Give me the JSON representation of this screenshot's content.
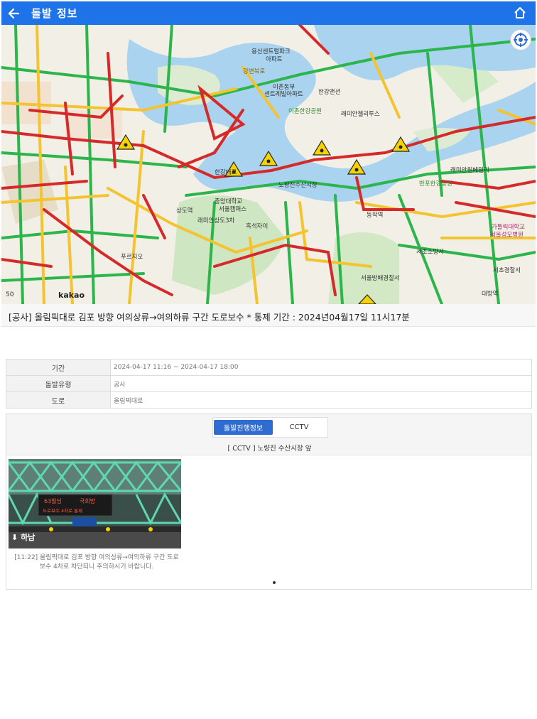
{
  "header": {
    "title": "돌발 정보"
  },
  "map": {
    "scale_label": "50",
    "brand": "kakao",
    "labels": [
      "용산센트럴파크",
      "아파트",
      "이촌동부",
      "센트레빌아파트",
      "한강맨션",
      "이촌한강공원",
      "래미안첼리투스",
      "강변북로",
      "중앙대학교",
      "서울캠퍼스",
      "흑석자이",
      "상도역",
      "동작역",
      "반포한강공원",
      "래미안원베일리",
      "서초소방서",
      "서울방배경찰서",
      "대방역",
      "래미안상도3차",
      "푸르지오",
      "서초경찰서",
      "가톨릭대학교",
      "서울성모병원",
      "노량진수산시장",
      "한강대교"
    ]
  },
  "event": {
    "title": "[공사] 올림픽대로 김포 방향 여의상류→여의하류 구간 도로보수 * 통제 기간 : 2024년04월17일 11시17분"
  },
  "info": {
    "rows": [
      {
        "label": "기간",
        "value": "2024-04-17 11:16 ~ 2024-04-17 18:00"
      },
      {
        "label": "돌발유형",
        "value": "공사"
      },
      {
        "label": "도로",
        "value": "올림픽대로"
      }
    ]
  },
  "tabs": {
    "progress": "돌발진행정보",
    "cctv": "CCTV"
  },
  "cctv": {
    "caption": "[ CCTV ] 노량진 수산시장 앞",
    "direction": "하남",
    "sign_left": "63빌딩",
    "sign_right": "국회방",
    "sign_sub": "도로보수 4차로 통제",
    "description": "[11:22] 올림픽대로 김포 방향 여의상류→여의하류 구간 도로보수 4차로 차단되니 주의하시기 바랍니다."
  },
  "colors": {
    "header_bg": "#1e73e8",
    "tab_active": "#2f6cd2",
    "road_smooth": "#2bb54a",
    "road_slow": "#f4c430",
    "road_jam": "#d42a2a",
    "river": "#a9d3ef"
  }
}
